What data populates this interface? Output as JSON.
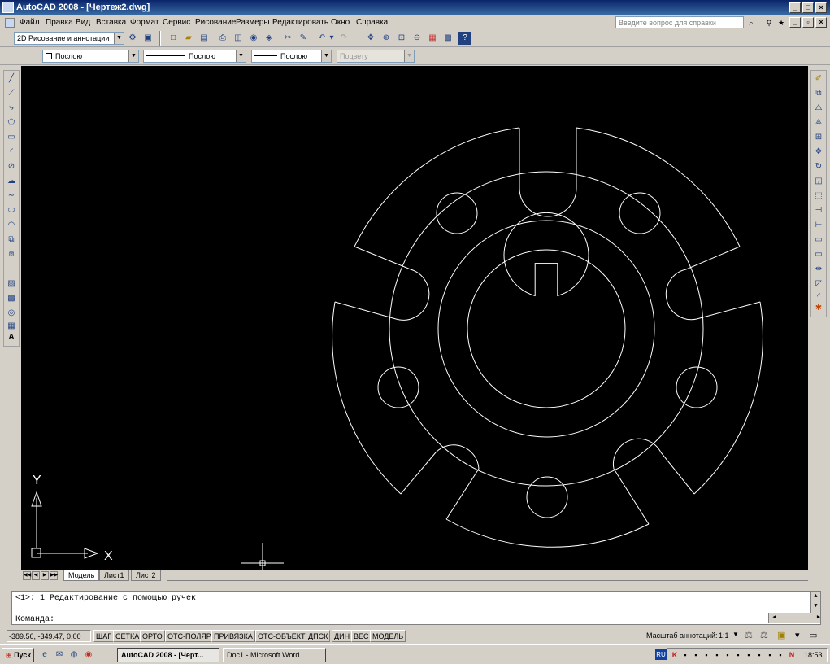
{
  "window": {
    "title": "AutoCAD 2008 - [Чертеж2.dwg]",
    "controls": [
      "_",
      "□",
      "×"
    ]
  },
  "menu": {
    "items": [
      "Файл",
      "Правка",
      "Вид",
      "Вставка",
      "Формат",
      "Сервис",
      "Рисование",
      "Размеры",
      "Редактировать",
      "Окно",
      "Справка"
    ],
    "help_placeholder": "Введите вопрос для справки"
  },
  "toolbar1": {
    "workspace": "2D Рисование и аннотации"
  },
  "toolbar2": {
    "layer": "Послою",
    "linetype": "Послою",
    "lineweight": "Послою",
    "plotstyle": "Поцвету"
  },
  "ucs": {
    "x_label": "X",
    "y_label": "Y"
  },
  "layout_tabs": [
    "Модель",
    "Лист1",
    "Лист2"
  ],
  "command": {
    "history": "<1>: 1 Редактирование с помощью ручек",
    "prompt": "Команда:"
  },
  "status": {
    "coords": "-389.56, -349.47, 0.00",
    "buttons": [
      "ШАГ",
      "СЕТКА",
      "ОРТО",
      "ОТС-ПОЛЯР",
      "ПРИВЯЗКА",
      "ОТС-ОБЪЕКТ",
      "ДПСК",
      "ДИН",
      "ВЕС",
      "МОДЕЛЬ"
    ],
    "annotation_scale_label": "Масштаб аннотаций:",
    "annotation_scale": "1:1"
  },
  "taskbar": {
    "start": "Пуск",
    "tasks": [
      "AutoCAD 2008 - [Черт...",
      "Doc1 - Microsoft Word"
    ],
    "lang": "RU",
    "clock": "18:53"
  },
  "colors": {
    "canvas": "#000000",
    "drawing": "#ffffff",
    "titlebar": "#0a246a"
  }
}
